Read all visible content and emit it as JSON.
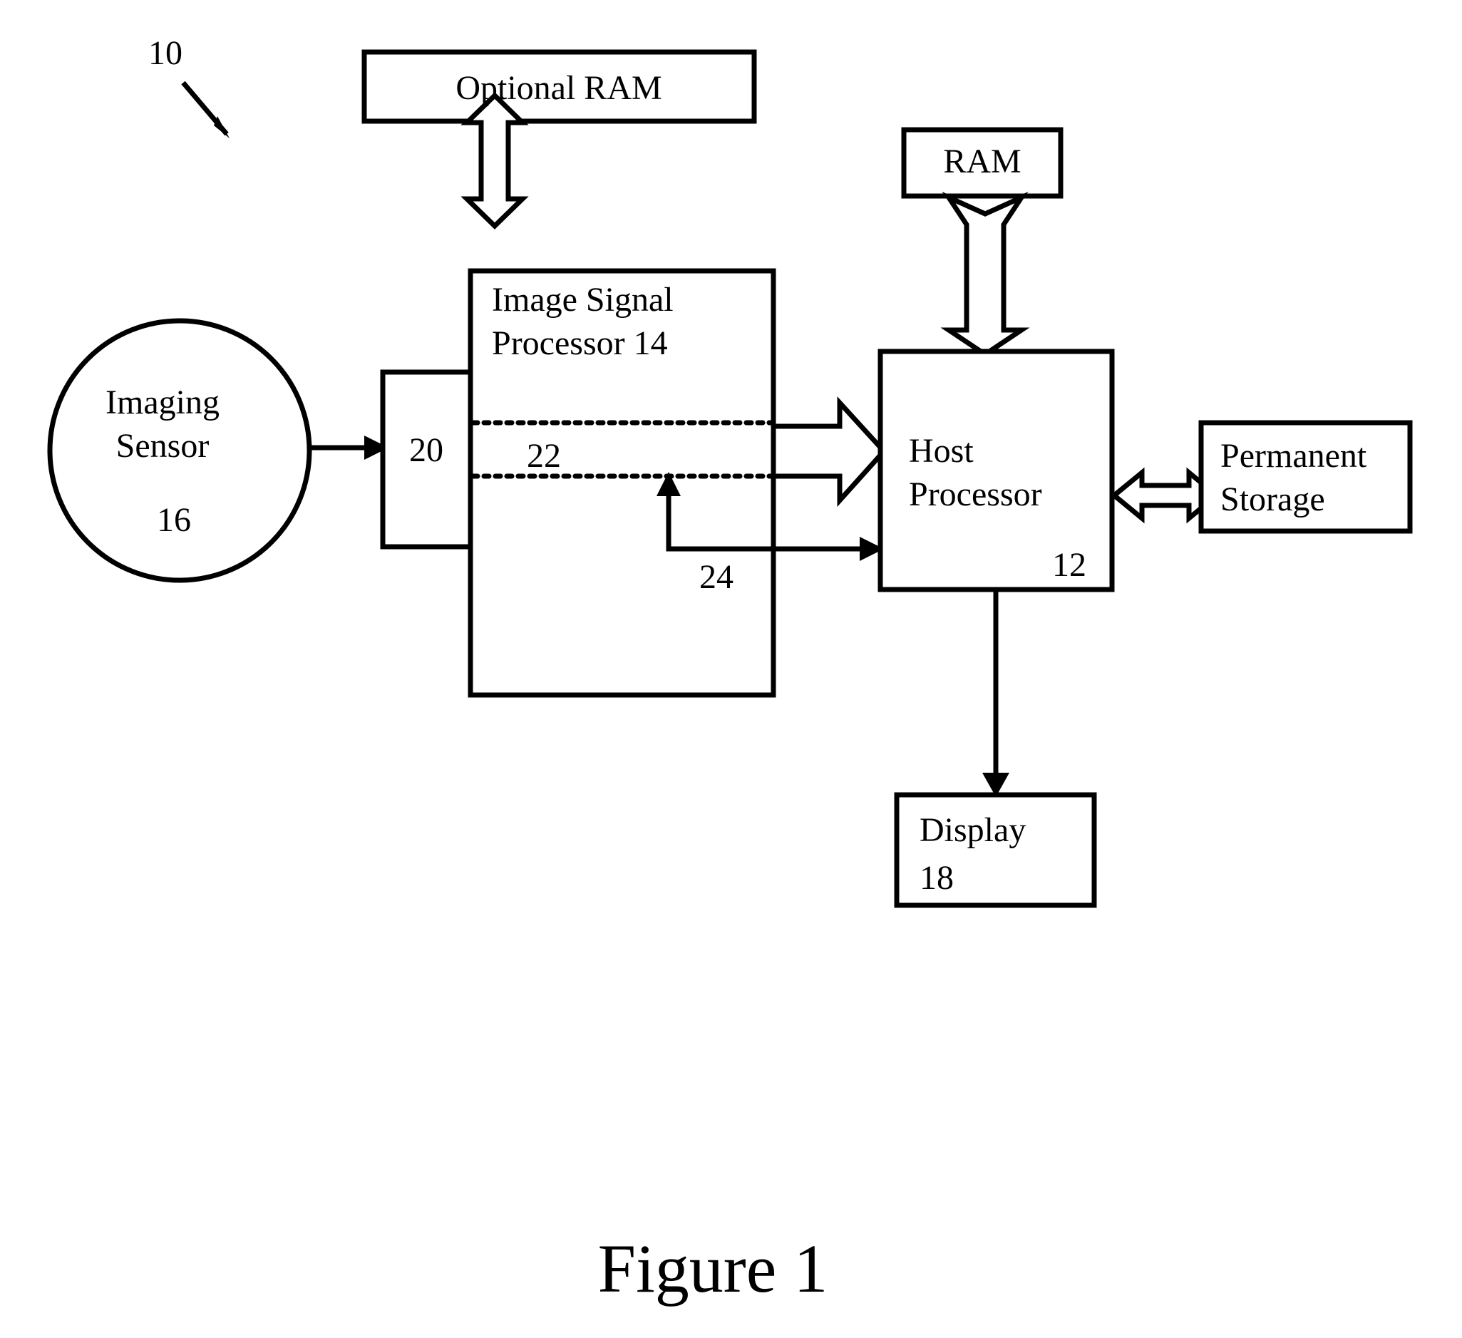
{
  "figure": {
    "caption": "Figure 1",
    "system_ref": "10"
  },
  "nodes": {
    "optional_ram": {
      "label": "Optional RAM"
    },
    "ram": {
      "label": "RAM"
    },
    "imaging_sensor": {
      "label_line1": "Imaging",
      "label_line2": "Sensor",
      "ref": "16"
    },
    "interface_20": {
      "ref": "20"
    },
    "image_signal_processor": {
      "label_line1": "Image Signal",
      "label_line2": "Processor 14",
      "band_ref": "22",
      "feedback_ref": "24"
    },
    "host_processor": {
      "label_line1": "Host",
      "label_line2": "Processor",
      "ref": "12"
    },
    "permanent_storage": {
      "label_line1": "Permanent",
      "label_line2": "Storage"
    },
    "display": {
      "label": "Display",
      "ref": "18"
    }
  },
  "connections": [
    {
      "name": "sensor-to-interface",
      "style": "solid-arrow",
      "from": "imaging_sensor",
      "to": "interface_20"
    },
    {
      "name": "optional-ram-to-isp",
      "style": "hollow-double-arrow",
      "from": "optional_ram",
      "to": "image_signal_processor"
    },
    {
      "name": "isp-to-host",
      "style": "hollow-arrow",
      "from": "image_signal_processor",
      "to": "host_processor"
    },
    {
      "name": "isp-feedback-24",
      "style": "solid-arrow",
      "from": "host_processor",
      "to": "image_signal_processor"
    },
    {
      "name": "ram-to-host",
      "style": "hollow-double-arrow",
      "from": "ram",
      "to": "host_processor"
    },
    {
      "name": "host-to-permanent-storage",
      "style": "hollow-double-arrow",
      "from": "host_processor",
      "to": "permanent_storage"
    },
    {
      "name": "host-to-display",
      "style": "solid-arrow",
      "from": "host_processor",
      "to": "display"
    }
  ],
  "colors": {
    "stroke": "#000000",
    "fill": "#ffffff",
    "background": "#ffffff"
  }
}
